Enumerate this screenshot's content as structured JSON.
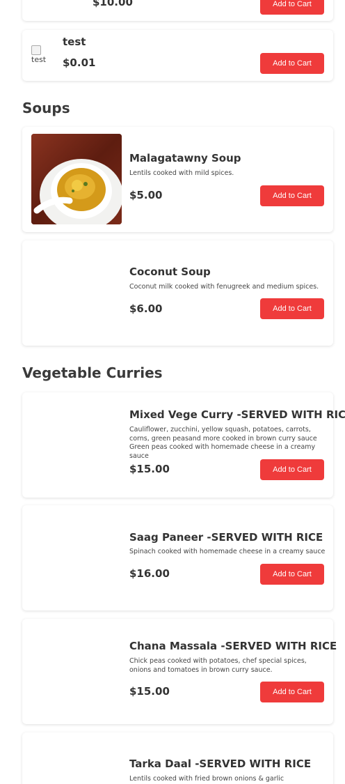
{
  "items_top": [
    {
      "price": "$10.00",
      "button": "Add to Cart"
    },
    {
      "name": "test",
      "image_alt": "test",
      "price": "$0.01",
      "button": "Add to Cart"
    }
  ],
  "sections": [
    {
      "title": "Soups",
      "items": [
        {
          "name": "Malagatawny Soup",
          "desc": "Lentils cooked with mild spices.",
          "price": "$5.00",
          "button": "Add to Cart"
        },
        {
          "name": "Coconut Soup",
          "desc": "Coconut milk cooked with fenugreek and medium spices.",
          "price": "$6.00",
          "button": "Add to Cart"
        }
      ]
    },
    {
      "title": "Vegetable Curries",
      "items": [
        {
          "name": "Mixed Vege Curry -SERVED WITH RICE",
          "desc": "Cauliflower, zucchini, yellow squash, potatoes, carrots, corns, green peasand more cooked in brown curry sauce Green peas cooked with homemade cheese in a creamy sauce",
          "price": "$15.00",
          "button": "Add to Cart"
        },
        {
          "name": "Saag Paneer -SERVED WITH RICE",
          "desc": "Spinach cooked with homemade cheese in a creamy sauce",
          "price": "$16.00",
          "button": "Add to Cart"
        },
        {
          "name": "Chana Massala -SERVED WITH RICE",
          "desc": "Chick peas cooked with potatoes, chef special spices, onions and tomatoes in brown curry sauce.",
          "price": "$15.00",
          "button": "Add to Cart"
        },
        {
          "name": "Tarka Daal -SERVED WITH RICE",
          "desc": "Lentils cooked with fried brown onions & garlic"
        }
      ]
    }
  ],
  "colors": {
    "accent": "#ef3b3b",
    "text": "#333333",
    "card_bg": "#ffffff"
  }
}
